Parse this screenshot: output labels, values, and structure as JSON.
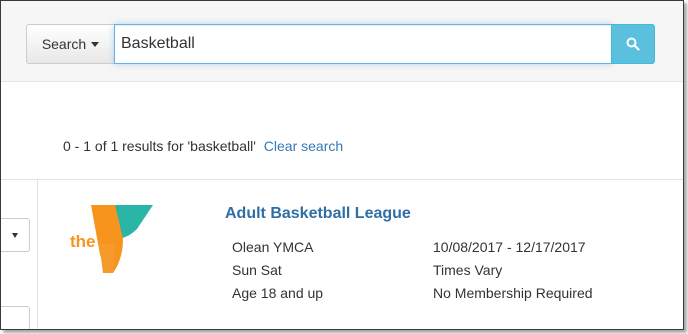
{
  "search": {
    "dropdown_label": "Search",
    "query": "Basketball",
    "button_icon": "search-icon"
  },
  "results": {
    "summary": "0 - 1 of 1 results for 'basketball'",
    "clear_label": "Clear search"
  },
  "sidebar": {
    "filter_icon": "caret-down-icon"
  },
  "program": {
    "title": "Adult Basketball League",
    "logo_alt": "YMCA logo",
    "location": "Olean YMCA",
    "dates": "10/08/2017 - 12/17/2017",
    "days": "Sun Sat",
    "times": "Times Vary",
    "age": "Age 18 and up",
    "membership": "No Membership Required"
  },
  "colors": {
    "link": "#337ab7",
    "title": "#2f6fa6",
    "search_button": "#5bc0de",
    "logo_orange": "#f7941d",
    "logo_teal": "#2bb5a6"
  }
}
